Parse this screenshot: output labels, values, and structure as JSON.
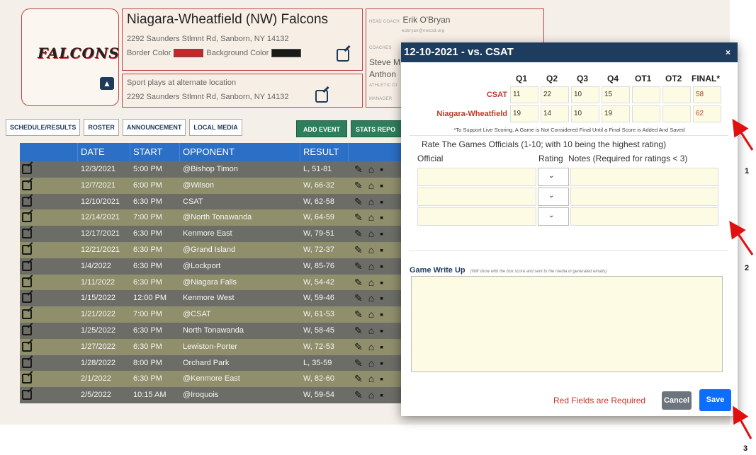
{
  "header": {
    "logo_text": "FALCONS",
    "school_name": "Niagara-Wheatfield (NW) Falcons",
    "address": "2292 Saunders Stlmnt Rd, Sanborn, NY 14132",
    "border_color_label": "Border Color",
    "border_color": "#c62828",
    "background_color_label": "Background Color",
    "background_color": "#1a1a1a",
    "alt_location_note": "Sport plays at alternate location",
    "alt_location_address": "2292 Saunders Stlmnt Rd, Sanborn, NY 14132",
    "coach": {
      "head_coach_label": "HEAD COACH",
      "head_coach_name": "Erik O'Bryan",
      "head_coach_email": "eobryan@nwcsd.org",
      "coaches_label": "COACHES",
      "coach_2_partial": "Steve M",
      "coach_3_partial": "Anthon",
      "athletic_dir_label": "ATHLETIC DI",
      "manager_label": "MANAGER"
    }
  },
  "tabs": [
    "SCHEDULE/RESULTS",
    "ROSTER",
    "ANNOUNCEMENT",
    "LOCAL MEDIA"
  ],
  "buttons": {
    "add_event": "ADD EVENT",
    "stats_report": "STATS REPO"
  },
  "schedule": {
    "columns": [
      "DATE",
      "START",
      "OPPONENT",
      "RESULT"
    ],
    "rows": [
      {
        "date": "12/3/2021",
        "start": "5:00 PM",
        "opponent": "@Bishop Timon",
        "result": "L, 51-81"
      },
      {
        "date": "12/7/2021",
        "start": "6:00 PM",
        "opponent": "@Wilson",
        "result": "W, 66-32"
      },
      {
        "date": "12/10/2021",
        "start": "6:30 PM",
        "opponent": "CSAT",
        "result": "W, 62-58"
      },
      {
        "date": "12/14/2021",
        "start": "7:00 PM",
        "opponent": "@North Tonawanda",
        "result": "W, 64-59"
      },
      {
        "date": "12/17/2021",
        "start": "6:30 PM",
        "opponent": "Kenmore East",
        "result": "W, 79-51"
      },
      {
        "date": "12/21/2021",
        "start": "6:30 PM",
        "opponent": "@Grand Island",
        "result": "W, 72-37"
      },
      {
        "date": "1/4/2022",
        "start": "6:30 PM",
        "opponent": "@Lockport",
        "result": "W, 85-76"
      },
      {
        "date": "1/11/2022",
        "start": "6:30 PM",
        "opponent": "@Niagara Falls",
        "result": "W, 54-42"
      },
      {
        "date": "1/15/2022",
        "start": "12:00 PM",
        "opponent": "Kenmore West",
        "result": "W, 59-46"
      },
      {
        "date": "1/21/2022",
        "start": "7:00 PM",
        "opponent": "@CSAT",
        "result": "W, 61-53"
      },
      {
        "date": "1/25/2022",
        "start": "6:30 PM",
        "opponent": "North Tonawanda",
        "result": "W, 58-45"
      },
      {
        "date": "1/27/2022",
        "start": "6:30 PM",
        "opponent": "Lewiston-Porter",
        "result": "W, 72-53"
      },
      {
        "date": "1/28/2022",
        "start": "8:00 PM",
        "opponent": "Orchard Park",
        "result": "L, 35-59"
      },
      {
        "date": "2/1/2022",
        "start": "6:30 PM",
        "opponent": "@Kenmore East",
        "result": "W, 82-60"
      },
      {
        "date": "2/5/2022",
        "start": "10:15 AM",
        "opponent": "@Iroquois",
        "result": "W, 59-54"
      }
    ]
  },
  "modal": {
    "title": "12-10-2021 - vs. CSAT",
    "close": "×",
    "score_columns": [
      "Q1",
      "Q2",
      "Q3",
      "Q4",
      "OT1",
      "OT2",
      "FINAL*"
    ],
    "teams": [
      {
        "name": "CSAT",
        "scores": [
          "11",
          "22",
          "10",
          "15",
          "",
          "",
          "58"
        ]
      },
      {
        "name": "Niagara-Wheatfield",
        "scores": [
          "19",
          "14",
          "10",
          "19",
          "",
          "",
          "62"
        ]
      }
    ],
    "live_note": "*To Support Live Scoring, A Game is Not Considered Final Until a Final Score is Added And Saved",
    "rate_title": "Rate The Games Officials (1-10; with 10 being the highest rating)",
    "official_label": "Official",
    "rating_label": "Rating",
    "notes_label": "Notes (Required for ratings < 3)",
    "writeup_label": "Game Write Up",
    "writeup_hint": "(Will show with the box score and sent to the media in generated emails)",
    "required_text": "Red Fields are Required",
    "cancel": "Cancel",
    "save": "Save"
  },
  "annotations": [
    "1",
    "2",
    "3"
  ]
}
